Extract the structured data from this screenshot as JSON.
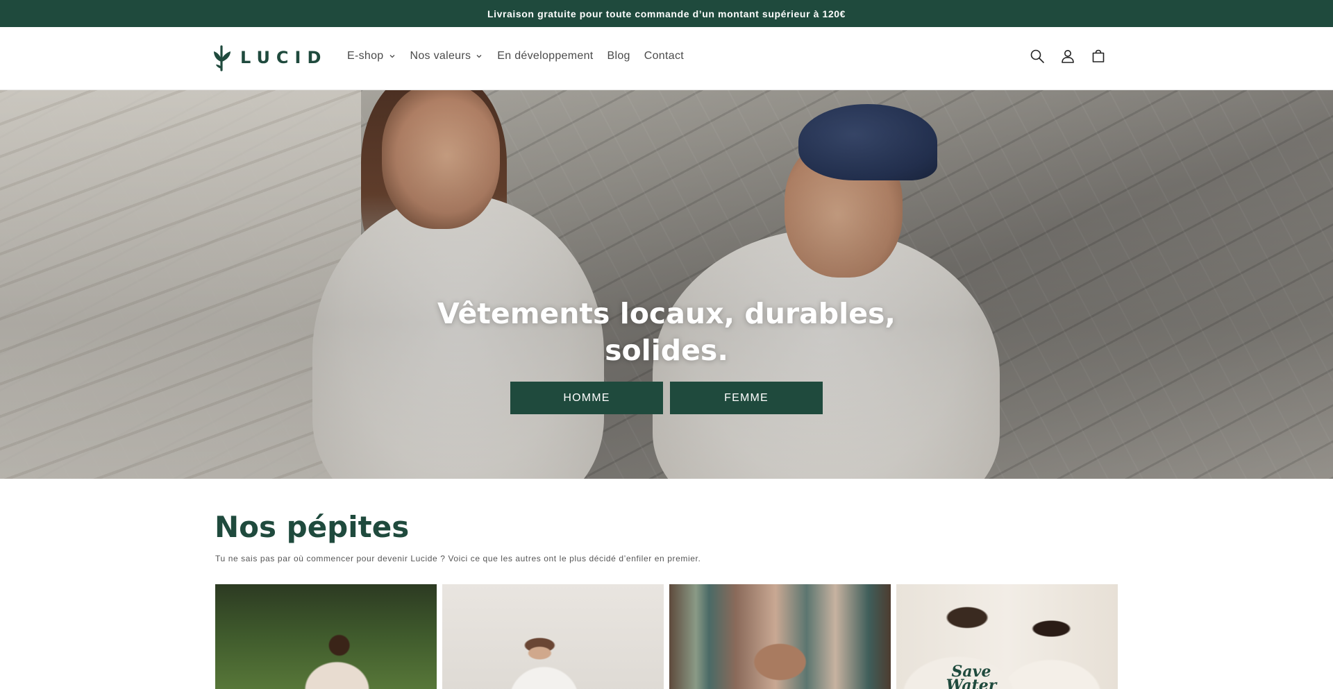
{
  "announcement": {
    "text": "Livraison gratuite pour toute commande d’un montant supérieur à 120€"
  },
  "header": {
    "logo_text": "LUCID",
    "nav": [
      {
        "label": "E-shop",
        "dropdown": true
      },
      {
        "label": "Nos valeurs",
        "dropdown": true
      },
      {
        "label": "En développement",
        "dropdown": false
      },
      {
        "label": "Blog",
        "dropdown": false
      },
      {
        "label": "Contact",
        "dropdown": false
      }
    ],
    "icons": [
      "search-icon",
      "account-icon",
      "cart-icon"
    ]
  },
  "hero": {
    "title": "Vêtements locaux, durables, solides.",
    "buttons": {
      "homme": "HOMME",
      "femme": "FEMME"
    }
  },
  "featured": {
    "title": "Nos pépites",
    "subtitle": "Tu ne sais pas par où commencer pour devenir Lucide ? Voici ce que les autres ont le plus décidé d’enfiler en premier.",
    "print_text": "Save Water"
  },
  "colors": {
    "brand": "#1f4a3d",
    "announcement_bg": "#1f4a3d",
    "nav_text": "#4a4a4a"
  }
}
